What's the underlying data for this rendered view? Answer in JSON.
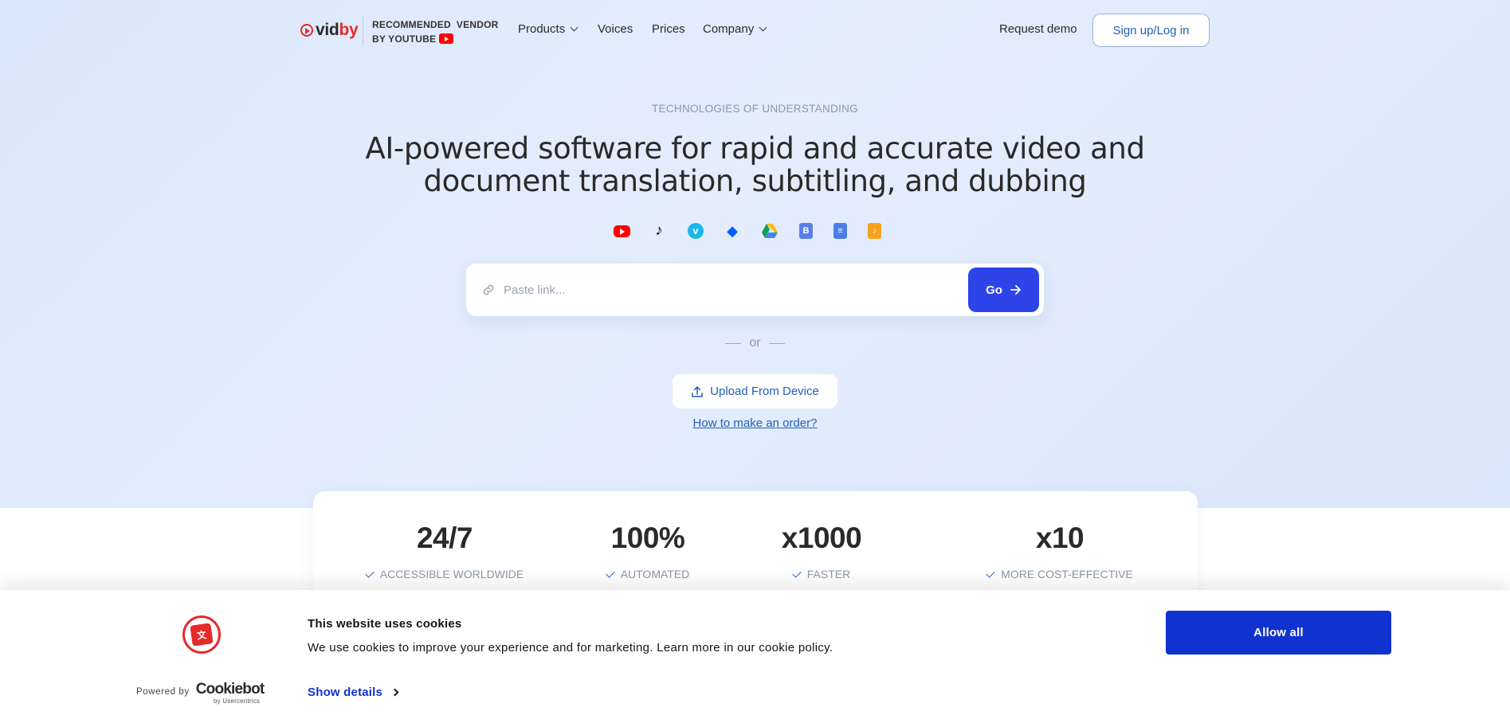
{
  "header": {
    "logo": {
      "part1": "vid",
      "part2": "by"
    },
    "vendor": {
      "line1": "RECOMMENDED  VENDOR",
      "line2": "BY YOUTUBE"
    },
    "nav": [
      {
        "label": "Products",
        "dropdown": true
      },
      {
        "label": "Voices",
        "dropdown": false
      },
      {
        "label": "Prices",
        "dropdown": false
      },
      {
        "label": "Company",
        "dropdown": true
      }
    ],
    "request_demo": "Request demo",
    "signup": "Sign up/Log in"
  },
  "hero": {
    "eyebrow": "TECHNOLOGIES OF UNDERSTANDING",
    "headline_line1": "AI-powered software for rapid and accurate video and",
    "headline_line2": "document translation, subtitling, and dubbing",
    "sources": [
      "youtube-icon",
      "tiktok-icon",
      "vimeo-icon",
      "dropbox-icon",
      "google-drive-icon",
      "document-icon",
      "google-docs-icon",
      "audio-file-icon"
    ],
    "link_placeholder": "Paste link...",
    "go_label": "Go",
    "or_label": "or",
    "upload_label": "Upload From Device",
    "howto_label": "How to make an order?"
  },
  "stats": [
    {
      "value": "24/7",
      "label": "ACCESSIBLE WORLDWIDE"
    },
    {
      "value": "100%",
      "label": "AUTOMATED"
    },
    {
      "value": "x1000",
      "label": "FASTER"
    },
    {
      "value": "x10",
      "label": "MORE COST-EFFECTIVE"
    }
  ],
  "cookie": {
    "title": "This website uses cookies",
    "text": "We use cookies to improve your experience and for marketing. Learn more in our cookie policy.",
    "powered_by": "Powered by",
    "brand": "Cookiebot",
    "brand_sub": "by Usercentrics",
    "show_details": "Show details",
    "allow_all": "Allow all"
  },
  "colors": {
    "brand_red": "#e52a2a",
    "primary_blue": "#2d45e8",
    "cookie_blue": "#1032cf",
    "link_blue": "#1f5fb8"
  }
}
